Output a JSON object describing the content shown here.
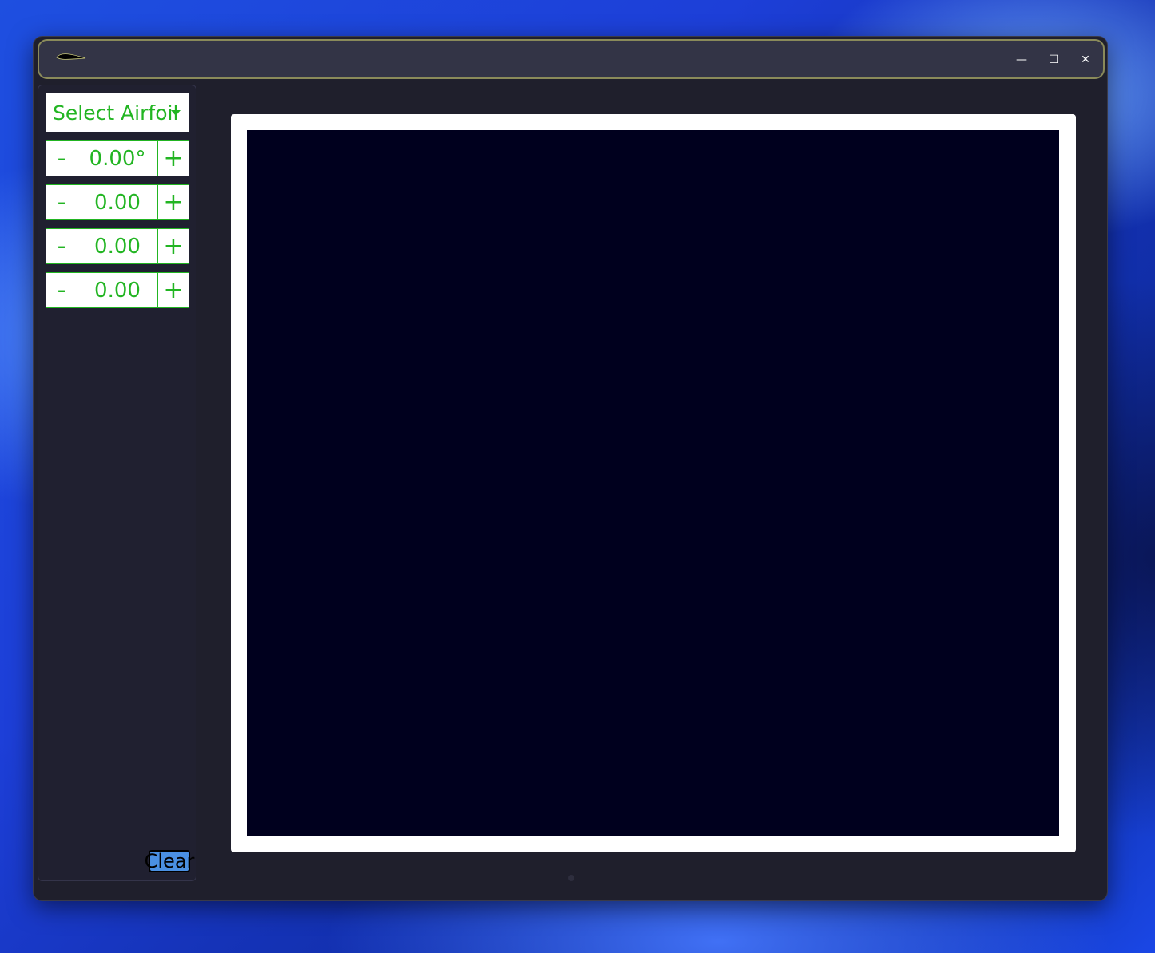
{
  "titlebar": {
    "icon": "airfoil-icon",
    "controls": {
      "minimize": "—",
      "maximize": "☐",
      "close": "✕"
    }
  },
  "sidebar": {
    "airfoil_select": {
      "label": "Select Airfoil",
      "icon": "chevron-down-icon"
    },
    "steppers": [
      {
        "minus": "-",
        "value": "0.00°",
        "plus": "+"
      },
      {
        "minus": "-",
        "value": "0.00",
        "plus": "+"
      },
      {
        "minus": "-",
        "value": "0.00",
        "plus": "+"
      },
      {
        "minus": "-",
        "value": "0.00",
        "plus": "+"
      }
    ],
    "clear_label": "Clear"
  },
  "colors": {
    "accent": "#22b522",
    "canvas": "#00001e",
    "window": "#1f1f2c",
    "clear_button": "#4a90e2"
  }
}
